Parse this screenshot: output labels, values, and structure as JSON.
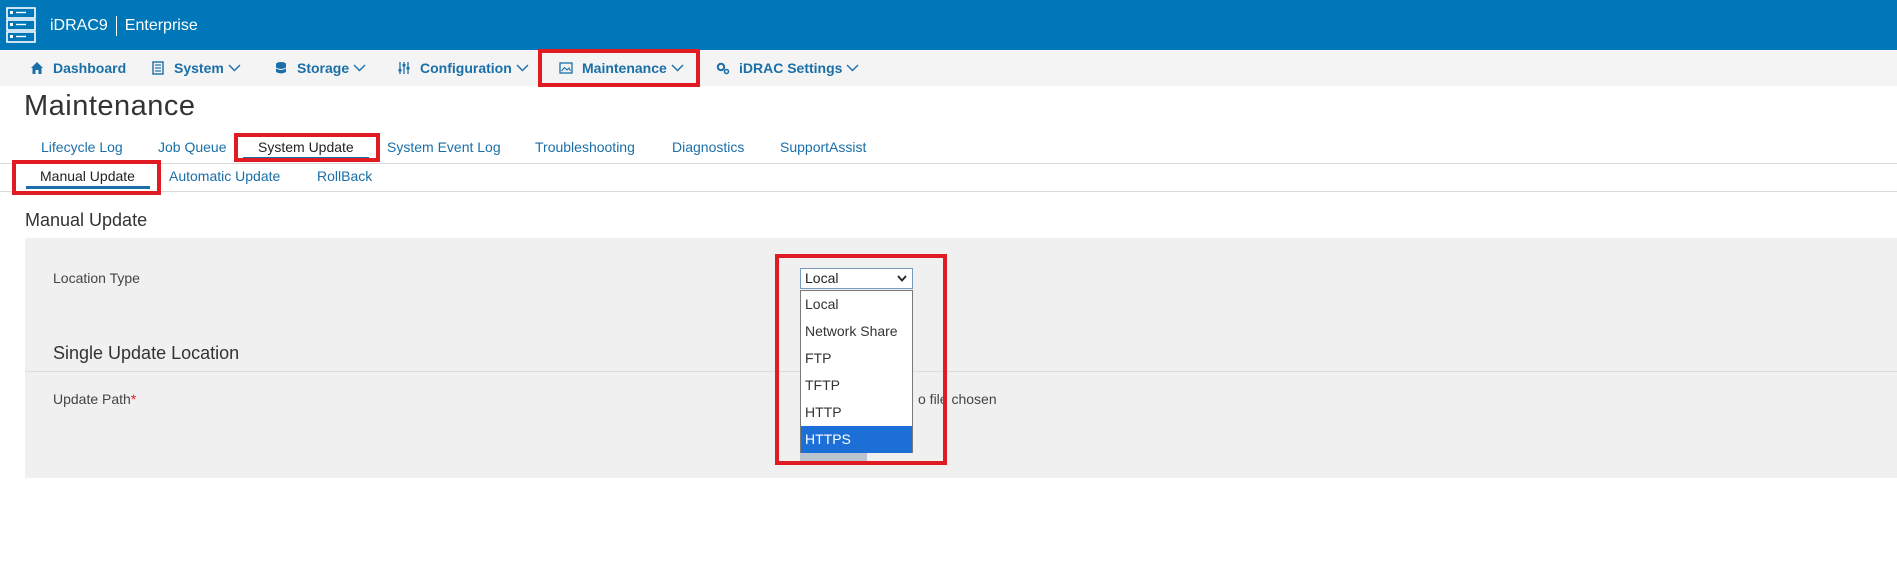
{
  "header": {
    "product": "iDRAC9",
    "edition": "Enterprise"
  },
  "nav": {
    "dashboard": "Dashboard",
    "system": "System",
    "storage": "Storage",
    "configuration": "Configuration",
    "maintenance": "Maintenance",
    "idrac_settings": "iDRAC Settings"
  },
  "page": {
    "title": "Maintenance"
  },
  "tabs": [
    "Lifecycle Log",
    "Job Queue",
    "System Update",
    "System Event Log",
    "Troubleshooting",
    "Diagnostics",
    "SupportAssist"
  ],
  "subtabs": [
    "Manual Update",
    "Automatic Update",
    "RollBack"
  ],
  "manual_update": {
    "section_title": "Manual Update",
    "location_type_label": "Location Type",
    "location_type_value": "Local",
    "location_options": [
      "Local",
      "Network Share",
      "FTP",
      "TFTP",
      "HTTP",
      "HTTPS"
    ],
    "highlighted_option": "HTTPS",
    "single_update_title": "Single Update Location",
    "update_path_label": "Update Path",
    "required_mark": "*",
    "no_file_text": "o file chosen"
  },
  "colors": {
    "header_blue": "#0077b8",
    "link_blue": "#1a6fa8",
    "highlight_red": "#e11b22",
    "selected_option": "#1d6fd8"
  }
}
